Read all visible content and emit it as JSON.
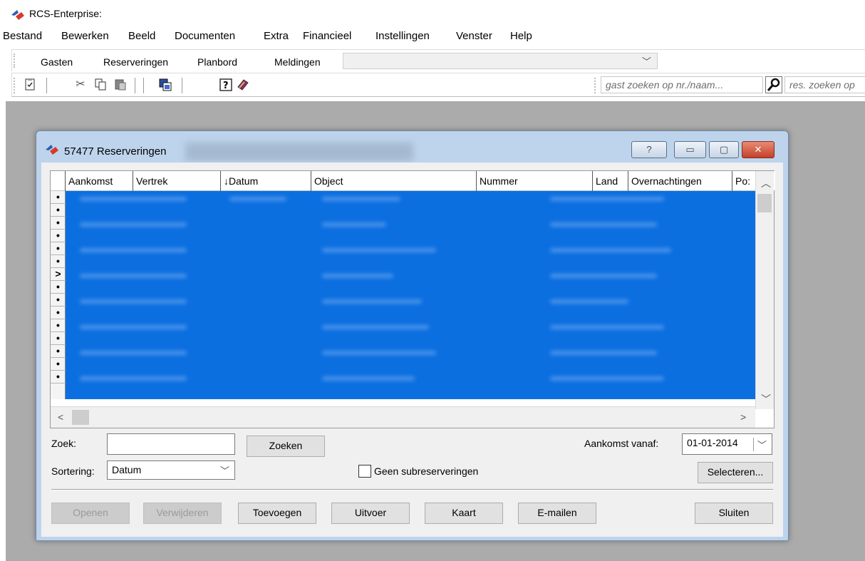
{
  "app": {
    "title": "RCS-Enterprise:"
  },
  "menu": [
    "Bestand",
    "Bewerken",
    "Beeld",
    "Documenten",
    "Extra",
    "Financieel",
    "Instellingen",
    "Venster",
    "Help"
  ],
  "tabs": [
    "Gasten",
    "Reserveringen",
    "Planbord",
    "Meldingen"
  ],
  "toolbar": {
    "guest_search_placeholder": "gast zoeken op nr./naam...",
    "res_search_placeholder": "res. zoeken op"
  },
  "dialog": {
    "title": "57477 Reserveringen",
    "help_button": "?",
    "columns": [
      "Aankomst",
      "Vertrek",
      "↓Datum",
      "Object",
      "Nummer",
      "Land",
      "Overnachtingen",
      "Po:"
    ],
    "row_markers": [
      "•",
      "•",
      "•",
      "•",
      "•",
      "•",
      ">",
      "•",
      "•",
      "•",
      "•",
      "•",
      "•",
      "•",
      "•"
    ],
    "search_label": "Zoek:",
    "search_value": "",
    "search_button": "Zoeken",
    "sort_label": "Sortering:",
    "sort_value": "Datum",
    "arrival_label": "Aankomst vanaf:",
    "arrival_value": "01-01-2014",
    "no_sub_label": "Geen subreserveringen",
    "select_button": "Selecteren...",
    "buttons": {
      "open": "Openen",
      "delete": "Verwijderen",
      "add": "Toevoegen",
      "export": "Uitvoer",
      "map": "Kaart",
      "email": "E-mailen",
      "close": "Sluiten"
    }
  }
}
